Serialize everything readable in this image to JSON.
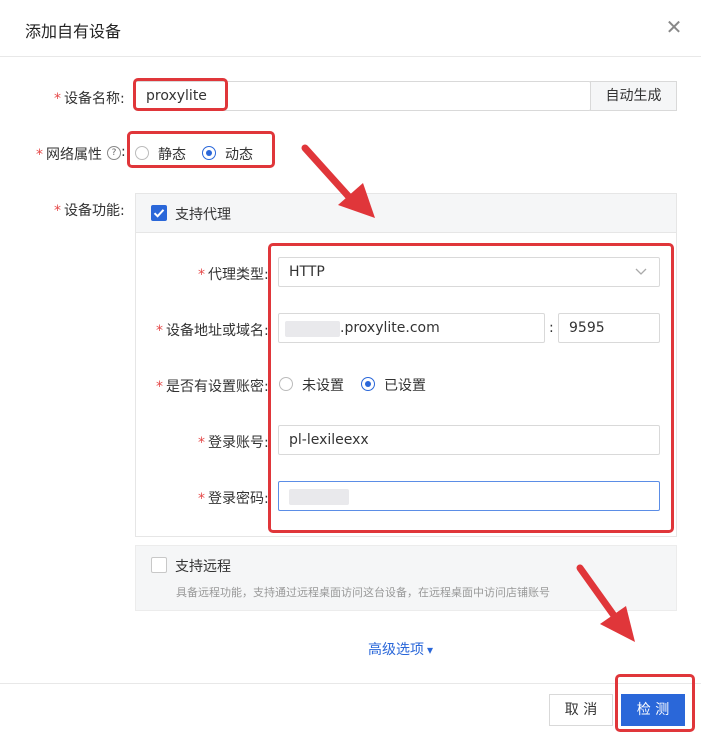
{
  "dialog": {
    "title": "添加自有设备",
    "close_symbol": "✕"
  },
  "device_name": {
    "label": "设备名称:",
    "value": "proxylite",
    "auto_button": "自动生成"
  },
  "network": {
    "label": "网络属性",
    "help_symbol": "?",
    "colon": ":",
    "options": [
      "静态",
      "动态"
    ],
    "selected": "动态"
  },
  "function": {
    "label": "设备功能:"
  },
  "proxy": {
    "checkbox_label": "支持代理",
    "checked": true,
    "type_label": "代理类型:",
    "type_value": "HTTP",
    "address_label": "设备地址或域名:",
    "address_value": ".proxylite.com",
    "address_sep": ":",
    "port_value": "9595",
    "auth_label": "是否有设置账密:",
    "auth_options": [
      "未设置",
      "已设置"
    ],
    "auth_selected": "已设置",
    "account_label": "登录账号:",
    "account_value": "pl-lexileexx",
    "password_label": "登录密码:"
  },
  "remote": {
    "checkbox_label": "支持远程",
    "checked": false,
    "desc": "具备远程功能，支持通过远程桌面访问这台设备，在远程桌面中访问店铺账号"
  },
  "advanced": {
    "label": "高级选项",
    "caret": "▾"
  },
  "footer": {
    "cancel": "取 消",
    "detect": "检 测"
  },
  "colors": {
    "primary": "#2a67d9",
    "required": "#e54848",
    "annotation": "#e0363a"
  }
}
